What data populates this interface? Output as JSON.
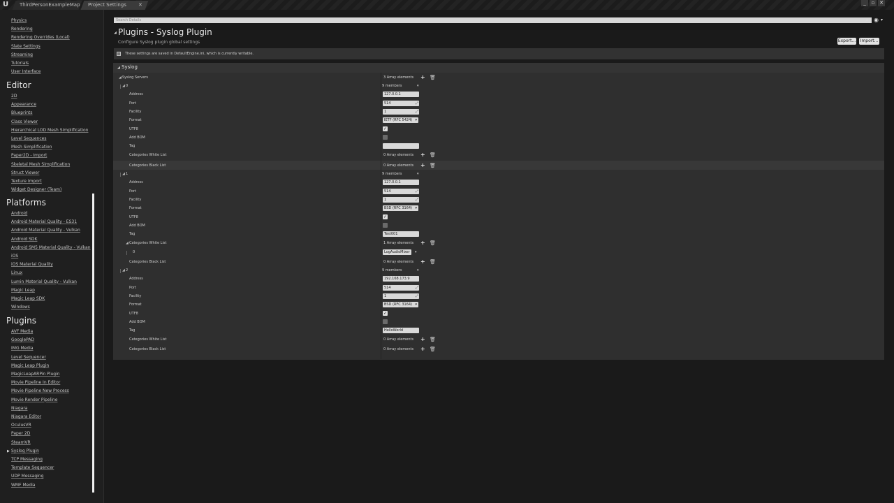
{
  "window": {
    "logo": "U",
    "tabs": [
      {
        "label": "ThirdPersonExampleMap"
      },
      {
        "label": "Project Settings"
      }
    ],
    "controls": [
      "_",
      "▫",
      "✕"
    ]
  },
  "sidebar": {
    "top_items": [
      "Physics",
      "Rendering",
      "Rendering Overrides (Local)",
      "Slate Settings",
      "Streaming",
      "Tutorials",
      "User Interface"
    ],
    "sections": [
      {
        "title": "Editor",
        "items": [
          "2D",
          "Appearance",
          "Blueprints",
          "Class Viewer",
          "Hierarchical LOD Mesh Simplification",
          "Level Sequences",
          "Mesh Simplification",
          "Paper2D - Import",
          "Skeletal Mesh Simplification",
          "Struct Viewer",
          "Texture Import",
          "Widget Designer (Team)"
        ]
      },
      {
        "title": "Platforms",
        "items": [
          "Android",
          "Android Material Quality - ES31",
          "Android Material Quality - Vulkan",
          "Android SDK",
          "Android SM5 Material Quality - Vulkan",
          "iOS",
          "iOS Material Quality",
          "Linux",
          "Lumin Material Quality - Vulkan",
          "Magic Leap",
          "Magic Leap SDK",
          "Windows"
        ]
      },
      {
        "title": "Plugins",
        "items": [
          "AVF Media",
          "GooglePAD",
          "IMG Media",
          "Level Sequencer",
          "Magic Leap Plugin",
          "MagicLeapARPin Plugin",
          "Movie Pipeline In Editor",
          "Movie Pipeline New Process",
          "Movie Render Pipeline",
          "Niagara",
          "Niagara Editor",
          "OculusVR",
          "Paper 2D",
          "SteamVR",
          "Syslog Plugin",
          "TCP Messaging",
          "Template Sequencer",
          "UDP Messaging",
          "WMF Media"
        ]
      }
    ],
    "selected": "Syslog Plugin"
  },
  "search": {
    "placeholder": "Search Details"
  },
  "header": {
    "title": "Plugins - Syslog Plugin",
    "subtitle": "Configure Syslog plugin global settings",
    "export_label": "Export...",
    "import_label": "Import...",
    "notice": "These settings are saved in DefaultEngine.ini, which is currently writable."
  },
  "syslog": {
    "section_label": "Syslog",
    "servers_label": "Syslog Servers",
    "servers_count": "3 Array elements",
    "labels": {
      "members": "9 members",
      "address": "Address",
      "port": "Port",
      "facility": "Facility",
      "format": "Format",
      "utf8": "UTF8",
      "add_bom": "Add BOM",
      "tag": "Tag",
      "white_list": "Categories White List",
      "black_list": "Categories Black List"
    },
    "servers": [
      {
        "index": "0",
        "address": "127.0.0.1",
        "port": "514",
        "facility": "1",
        "format": "IETF (RFC 5424)",
        "utf8": true,
        "add_bom": false,
        "tag": "",
        "white_count": "0 Array elements",
        "black_count": "0 Array elements"
      },
      {
        "index": "1",
        "address": "127.0.0.1",
        "port": "514",
        "facility": "1",
        "format": "BSD (RFC 3164)",
        "utf8": true,
        "add_bom": false,
        "tag": "Test001",
        "white_count": "1 Array elements",
        "white_items": [
          {
            "index": "0",
            "value": "LogAudioMixer"
          }
        ],
        "black_count": "0 Array elements"
      },
      {
        "index": "2",
        "address": "192.168.173.9",
        "port": "514",
        "facility": "1",
        "format": "BSD (RFC 3164)",
        "utf8": true,
        "add_bom": false,
        "tag": "HelloWorld",
        "white_count": "0 Array elements",
        "black_count": "0 Array elements"
      }
    ]
  }
}
